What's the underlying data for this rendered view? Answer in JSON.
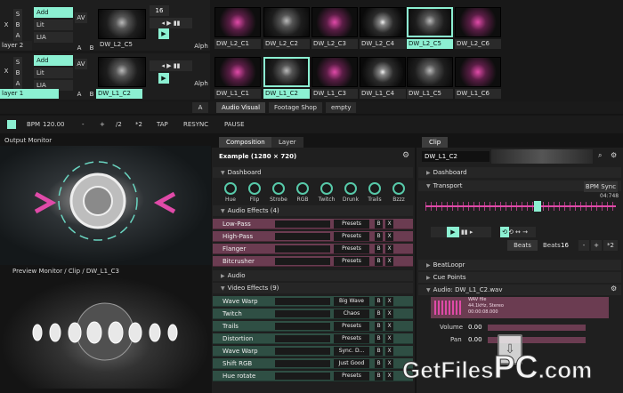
{
  "layers": {
    "layer2": {
      "name": "layer 2",
      "blend": "Add",
      "opt1": "Lit",
      "opt2": "LIA",
      "a": "A",
      "b": "B",
      "s": "S",
      "x": "X",
      "av": "AV",
      "alph": "Alph",
      "speed": "16"
    },
    "layer1": {
      "name": "layer 1",
      "blend": "Add",
      "opt1": "Lit",
      "opt2": "LIA",
      "a": "A",
      "b": "B",
      "s": "S",
      "x": "X",
      "av": "AV",
      "alph": "Alph"
    }
  },
  "clips_top": [
    "DW_L2_C5",
    "DW_L2_C1",
    "DW_L2_C2",
    "DW_L2_C3",
    "DW_L2_C4",
    "DW_L2_C5",
    "DW_L2_C6"
  ],
  "clips_bottom": [
    "DW_L1_C2",
    "DW_L1_C1",
    "DW_L1_C2",
    "DW_L1_C3",
    "DW_L1_C4",
    "DW_L1_C5",
    "DW_L1_C6"
  ],
  "deck_tabs": [
    "Audio Visual",
    "Footage Shop",
    "empty"
  ],
  "transport_bar": {
    "bpm_label": "BPM",
    "bpm": "120.00",
    "minus": "-",
    "plus": "+",
    "half": "/2",
    "double": "*2",
    "tap": "TAP",
    "resync": "RESYNC",
    "pause": "PAUSE"
  },
  "output_monitor": {
    "title": "Output Monitor"
  },
  "preview_monitor": {
    "title": "Preview Monitor / Clip / DW_L1_C3"
  },
  "center_tabs": [
    "Composition",
    "Layer"
  ],
  "composition": {
    "title": "Example (1280 × 720)",
    "dashboard": "Dashboard",
    "knobs": [
      "Hue",
      "Flip",
      "Strobe",
      "RGB",
      "Twitch",
      "Drunk",
      "Trails",
      "Bzzz"
    ],
    "audio_effects_header": "Audio Effects (4)",
    "audio_effects": [
      {
        "name": "Low-Pass",
        "preset": "Presets"
      },
      {
        "name": "High-Pass",
        "preset": "Presets"
      },
      {
        "name": "Flanger",
        "preset": "Presets"
      },
      {
        "name": "Bitcrusher",
        "preset": "Presets"
      }
    ],
    "audio_header": "Audio",
    "video_effects_header": "Video Effects (9)",
    "video_effects": [
      {
        "name": "Wave Warp",
        "preset": "Big Wave"
      },
      {
        "name": "Twitch",
        "preset": "Chaos"
      },
      {
        "name": "Trails",
        "preset": "Presets"
      },
      {
        "name": "Distortion",
        "preset": "Presets"
      },
      {
        "name": "Wave Warp",
        "preset": "Sync. D..."
      },
      {
        "name": "Shift RGB",
        "preset": "Just Good"
      },
      {
        "name": "Hue rotate",
        "preset": "Presets"
      }
    ],
    "btn_b": "B",
    "btn_x": "X"
  },
  "clip_panel": {
    "tab": "Clip",
    "clip_name": "DW_L1_C2",
    "dashboard": "Dashboard",
    "transport": "Transport",
    "bpm_sync": "BPM Sync",
    "time": "04:748",
    "beats_label": "Beats",
    "beats_btn": "Beats",
    "beats_value": "16",
    "beatloopr": "BeatLoopr",
    "cue_points": "Cue Points",
    "audio_file": "Audio: DW_L1_C2.wav",
    "wav_type": "WAV file",
    "wav_rate": "44.1kHz, Stereo",
    "wav_time": "00:00:08.000",
    "volume_label": "Volume",
    "volume_value": "0.00",
    "pan_label": "Pan",
    "pan_value": "0.00"
  },
  "watermark": {
    "brand_a": "GetFiles",
    "brand_b": "PC",
    "brand_c": ".com"
  },
  "colors": {
    "accent": "#8cf0d2",
    "audio_fx": "#6b3c51",
    "video_fx": "#2f4f44",
    "pink": "#e04aa8"
  }
}
